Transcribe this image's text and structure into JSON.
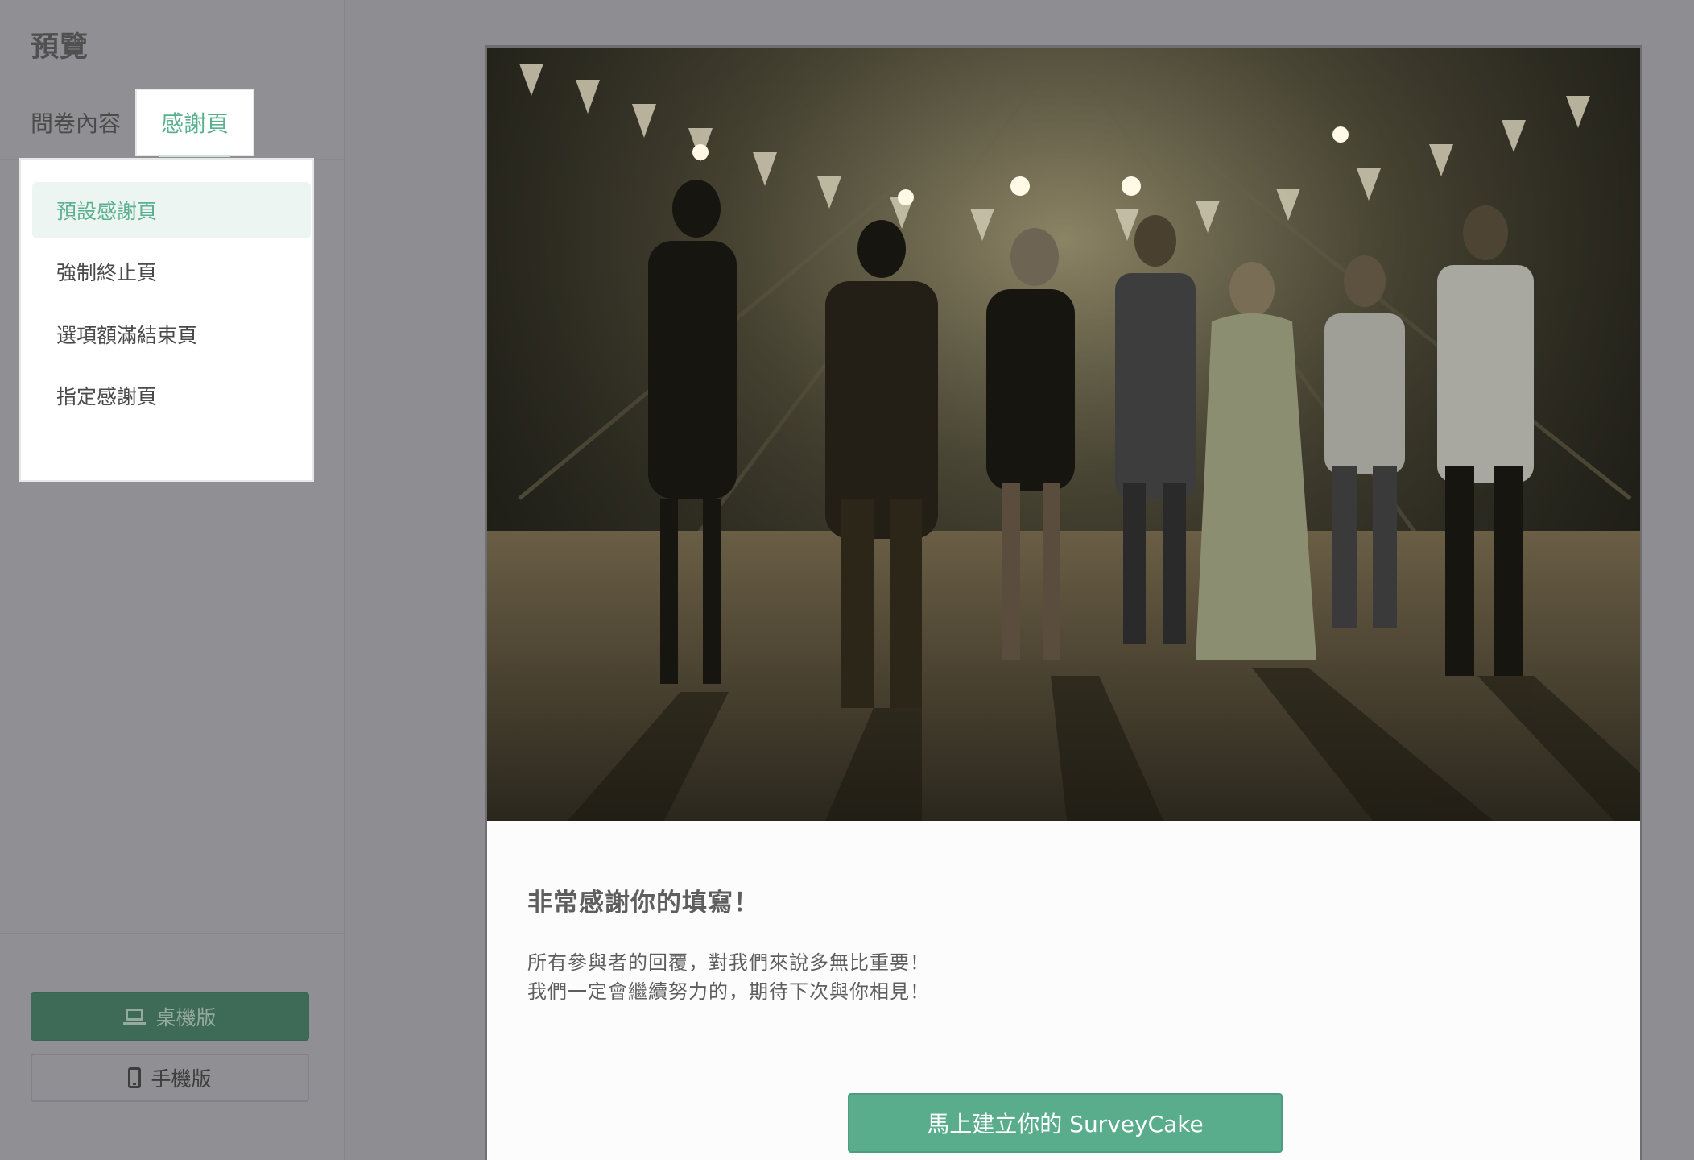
{
  "sidebar": {
    "title": "預覽",
    "tabs": [
      {
        "label": "問卷內容",
        "active": false
      },
      {
        "label": "感謝頁",
        "active": true
      }
    ],
    "dropdown_items": [
      {
        "label": "預設感謝頁",
        "active": true
      },
      {
        "label": "強制終止頁",
        "active": false
      },
      {
        "label": "選項額滿結束頁",
        "active": false
      },
      {
        "label": "指定感謝頁",
        "active": false
      }
    ],
    "device_buttons": {
      "desktop": {
        "label": "桌機版",
        "icon": "laptop-icon",
        "active": true
      },
      "mobile": {
        "label": "手機版",
        "icon": "phone-icon",
        "active": false
      }
    }
  },
  "preview": {
    "hero_image": "party-dance-photo",
    "thanks_title": "非常感謝你的填寫！",
    "thanks_body": [
      "所有參與者的回覆，對我們來說多無比重要！",
      "我們一定會繼續努力的，期待下次與你相見！"
    ],
    "cta_label": "馬上建立你的 SurveyCake"
  },
  "colors": {
    "accent": "#5aad8c",
    "desktop_button_bg": "#3e6b58",
    "overlay_bg": "#8e8d92"
  }
}
